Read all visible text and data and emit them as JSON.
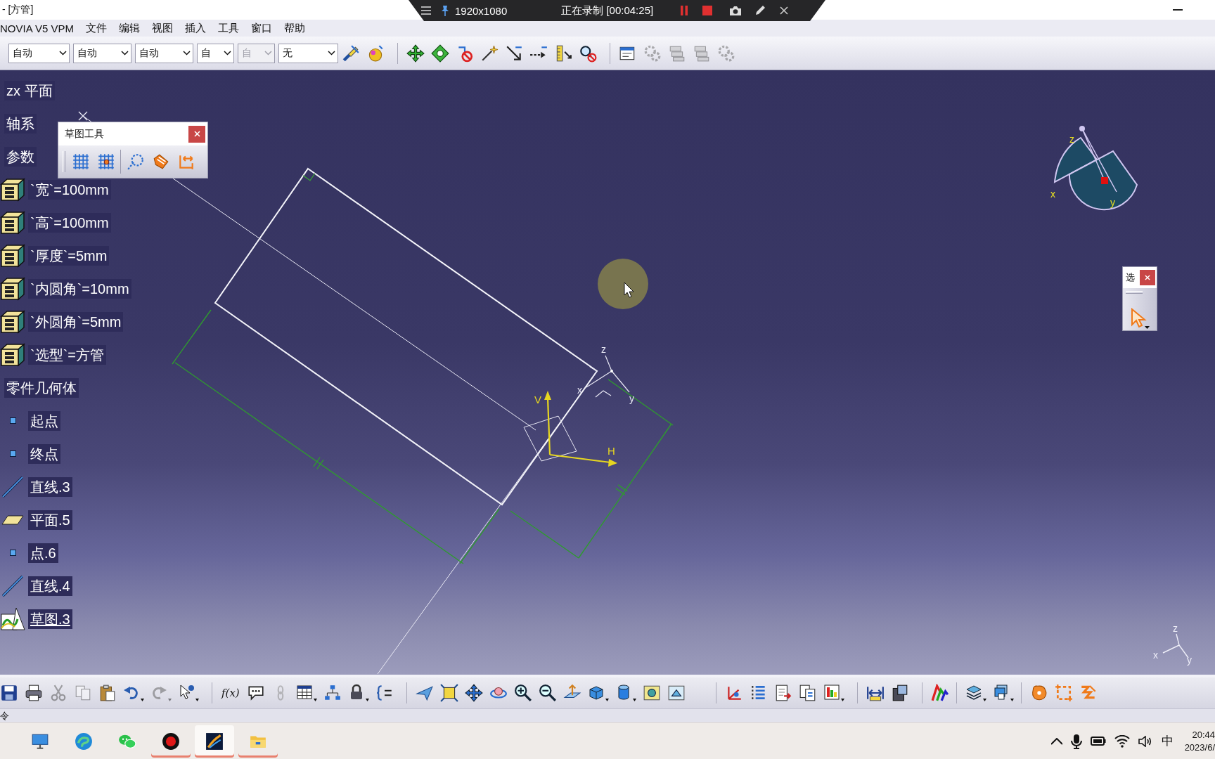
{
  "title_bar": {
    "title": "- [方管]"
  },
  "recorder": {
    "resolution": "1920x1080",
    "status": "正在录制 [00:04:25]"
  },
  "menu_bar": [
    "NOVIA V5 VPM",
    "文件",
    "编辑",
    "视图",
    "插入",
    "工具",
    "窗口",
    "帮助"
  ],
  "toolbar": {
    "dropdowns": [
      {
        "value": "自动",
        "disabled": false
      },
      {
        "value": "自动",
        "disabled": false
      },
      {
        "value": "自动",
        "disabled": false
      },
      {
        "value": "自",
        "disabled": false
      },
      {
        "value": "自",
        "disabled": true
      },
      {
        "value": "无",
        "disabled": false
      }
    ],
    "groups": [
      {
        "tools": [
          {
            "disabled": false
          },
          {
            "disabled": false
          }
        ]
      },
      {
        "tools": [
          {
            "disabled": false
          },
          {
            "disabled": false
          },
          {
            "disabled": false
          },
          {
            "disabled": false
          },
          {
            "disabled": false
          },
          {
            "disabled": false
          },
          {
            "disabled": false
          },
          {
            "disabled": false
          }
        ]
      },
      {
        "tools": [
          {
            "disabled": false
          },
          {
            "disabled": true
          },
          {
            "disabled": true
          },
          {
            "disabled": true
          },
          {
            "disabled": true
          }
        ]
      }
    ]
  },
  "tree": [
    {
      "label": "zx 平面"
    },
    {
      "label": "轴系"
    },
    {
      "label": "参数",
      "children": [
        {
          "kind": "parameter",
          "label": "`宽`=100mm"
        },
        {
          "kind": "parameter",
          "label": "`高`=100mm"
        },
        {
          "kind": "parameter",
          "label": "`厚度`=5mm"
        },
        {
          "kind": "parameter",
          "label": "`内圆角`=10mm"
        },
        {
          "kind": "parameter",
          "label": "`外圆角`=5mm"
        },
        {
          "kind": "parameter",
          "label": "`选型`=方管"
        }
      ]
    },
    {
      "label": "零件几何体",
      "children": [
        {
          "kind": "point",
          "label": "起点",
          "current": false
        },
        {
          "kind": "point",
          "label": "终点",
          "current": false
        },
        {
          "kind": "line",
          "label": "直线.3",
          "current": false
        },
        {
          "kind": "plane",
          "label": "平面.5",
          "current": false
        },
        {
          "kind": "point",
          "label": "点.6",
          "current": false
        },
        {
          "kind": "line",
          "label": "直线.4",
          "current": false
        },
        {
          "kind": "sketch",
          "label": "草图.3",
          "current": true
        }
      ]
    }
  ],
  "sketch_tools": {
    "title": "草图工具"
  },
  "select_panel": {
    "title": "选"
  },
  "viewer": {
    "sketch_axes": [
      "H",
      "V"
    ],
    "part_axes": [
      "z",
      "x",
      "y"
    ],
    "compass": [
      "z",
      "x",
      "y"
    ],
    "corner_axes": [
      "z",
      "x",
      "y"
    ]
  },
  "bottom_toolbar": {
    "groups": [
      {
        "tools": [
          {
            "disabled": false
          },
          {
            "disabled": false
          },
          {
            "disabled": true
          },
          {
            "disabled": true
          },
          {
            "disabled": false
          },
          {
            "disabled": false
          },
          {
            "disabled": true
          },
          {
            "disabled": false
          }
        ]
      },
      {
        "tools": [
          {
            "label": "f(x)",
            "disabled": false
          },
          {
            "disabled": false
          },
          {
            "disabled": true
          },
          {
            "disabled": false
          },
          {
            "disabled": false
          },
          {
            "disabled": false
          },
          {
            "disabled": false
          }
        ]
      },
      {
        "tools": [
          {
            "disabled": false
          },
          {
            "disabled": false
          },
          {
            "disabled": false
          },
          {
            "disabled": false
          },
          {
            "disabled": false
          },
          {
            "disabled": false
          },
          {
            "disabled": false
          },
          {
            "disabled": false
          },
          {
            "disabled": false
          },
          {
            "disabled": false
          },
          {
            "disabled": false
          }
        ]
      },
      {
        "tools": [
          {
            "disabled": false
          },
          {
            "disabled": false
          },
          {
            "disabled": false
          },
          {
            "disabled": false
          },
          {
            "disabled": false
          }
        ]
      },
      {
        "tools": [
          {
            "disabled": false
          },
          {
            "disabled": false
          }
        ]
      },
      {
        "tools": [
          {
            "disabled": false
          }
        ]
      },
      {
        "tools": [
          {
            "disabled": false
          },
          {
            "disabled": false
          }
        ]
      },
      {
        "tools": [
          {
            "disabled": false
          },
          {
            "disabled": false
          },
          {
            "disabled": false
          }
        ]
      }
    ]
  },
  "status_bar": {
    "text": "令"
  },
  "taskbar": {
    "apps": [
      {
        "running": false,
        "active": false
      },
      {
        "running": false,
        "active": false
      },
      {
        "running": false,
        "active": false
      },
      {
        "running": true,
        "active": false
      },
      {
        "running": true,
        "active": true
      },
      {
        "running": true,
        "active": false
      }
    ],
    "tray": {
      "input_method": "中",
      "time": "20:44",
      "date": "2023/6/"
    }
  }
}
